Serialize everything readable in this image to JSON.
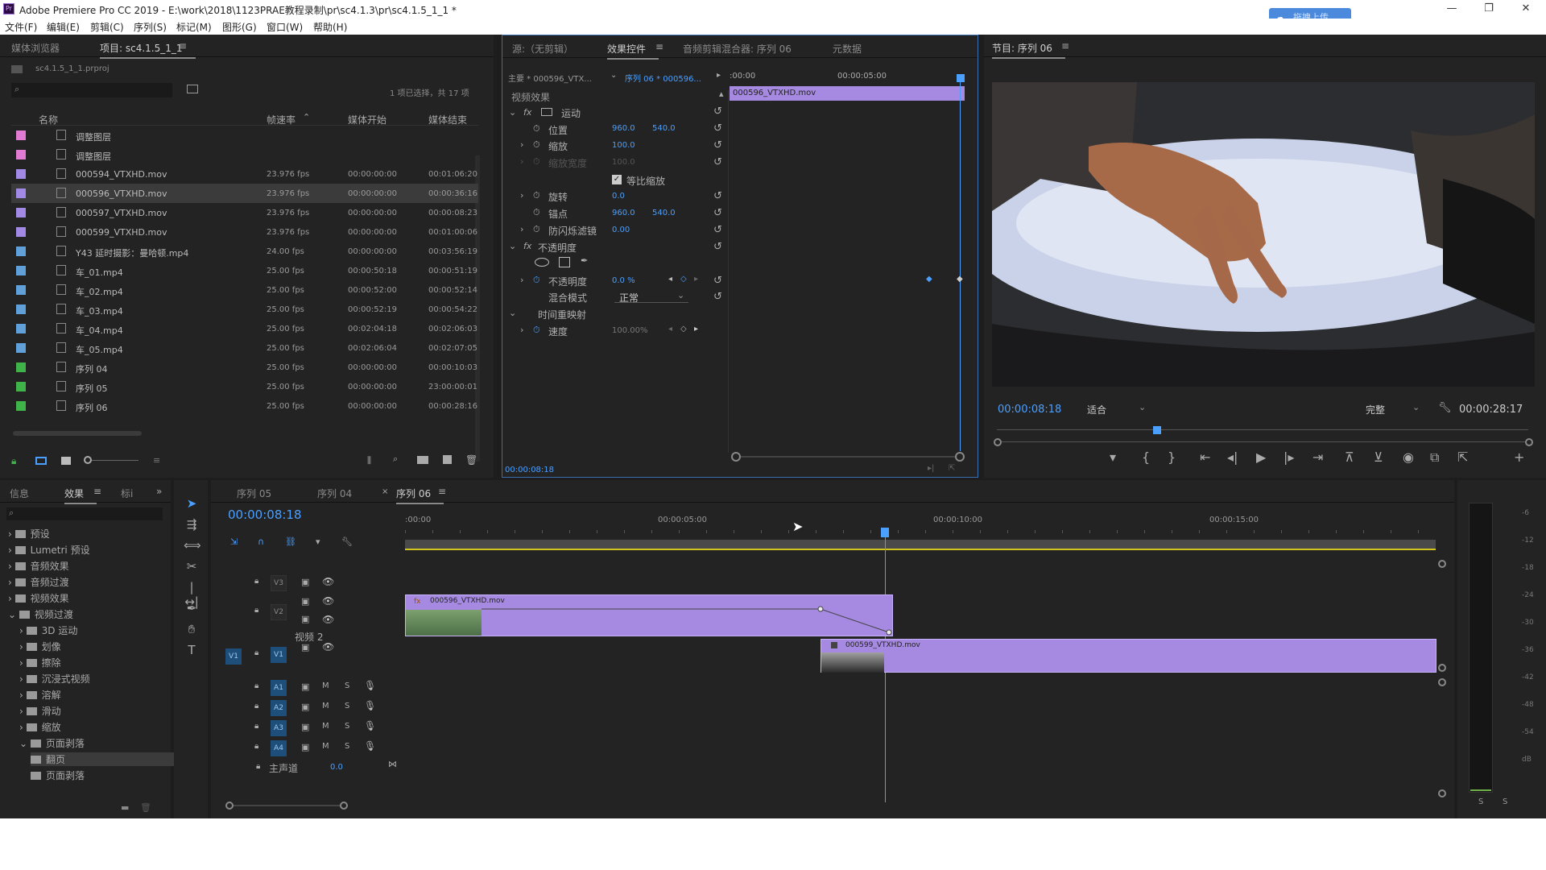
{
  "window": {
    "app_icon": "Pr",
    "title": "Adobe Premiere Pro CC 2019 - E:\\work\\2018\\1123PRAE教程录制\\pr\\sc4.1.3\\pr\\sc4.1.5_1_1 *",
    "upload_label": "拖拽上传",
    "minimize": "—",
    "maximize": "❐",
    "close": "✕"
  },
  "menu": [
    "文件(F)",
    "编辑(E)",
    "剪辑(C)",
    "序列(S)",
    "标记(M)",
    "图形(G)",
    "窗口(W)",
    "帮助(H)"
  ],
  "project": {
    "tabs": [
      "媒体浏览器",
      "项目: sc4.1.5_1_1"
    ],
    "file": "sc4.1.5_1_1.prproj",
    "status": "1 项已选择，共 17 项",
    "columns": [
      "名称",
      "帧速率",
      "媒体开始",
      "媒体结束"
    ],
    "rows": [
      {
        "name": "调整图层",
        "fps": "",
        "start": "",
        "end": "",
        "color": "#e07bd4",
        "icon": "adjust-icon"
      },
      {
        "name": "调整图层",
        "fps": "",
        "start": "",
        "end": "",
        "color": "#e07bd4",
        "icon": "adjust-icon"
      },
      {
        "name": "000594_VTXHD.mov",
        "fps": "23.976 fps",
        "start": "00:00:00:00",
        "end": "00:01:06:20",
        "color": "#a18ae6",
        "icon": "clip-icon"
      },
      {
        "name": "000596_VTXHD.mov",
        "fps": "23.976 fps",
        "start": "00:00:00:00",
        "end": "00:00:36:16",
        "color": "#a18ae6",
        "icon": "clip-icon"
      },
      {
        "name": "000597_VTXHD.mov",
        "fps": "23.976 fps",
        "start": "00:00:00:00",
        "end": "00:00:08:23",
        "color": "#a18ae6",
        "icon": "clip-icon"
      },
      {
        "name": "000599_VTXHD.mov",
        "fps": "23.976 fps",
        "start": "00:00:00:00",
        "end": "00:01:00:06",
        "color": "#a18ae6",
        "icon": "clip-icon"
      },
      {
        "name": "Y43 延时摄影：曼哈顿.mp4",
        "fps": "24.00 fps",
        "start": "00:00:00:00",
        "end": "00:03:56:19",
        "color": "#5fa0d8",
        "icon": "av-clip-icon"
      },
      {
        "name": "车_01.mp4",
        "fps": "25.00 fps",
        "start": "00:00:50:18",
        "end": "00:00:51:19",
        "color": "#5fa0d8",
        "icon": "av-clip-icon"
      },
      {
        "name": "车_02.mp4",
        "fps": "25.00 fps",
        "start": "00:00:52:00",
        "end": "00:00:52:14",
        "color": "#5fa0d8",
        "icon": "av-clip-icon"
      },
      {
        "name": "车_03.mp4",
        "fps": "25.00 fps",
        "start": "00:00:52:19",
        "end": "00:00:54:22",
        "color": "#5fa0d8",
        "icon": "av-clip-icon"
      },
      {
        "name": "车_04.mp4",
        "fps": "25.00 fps",
        "start": "00:02:04:18",
        "end": "00:02:06:03",
        "color": "#5fa0d8",
        "icon": "av-clip-icon"
      },
      {
        "name": "车_05.mp4",
        "fps": "25.00 fps",
        "start": "00:02:06:04",
        "end": "00:02:07:05",
        "color": "#5fa0d8",
        "icon": "av-clip-icon"
      },
      {
        "name": "序列 04",
        "fps": "25.00 fps",
        "start": "00:00:00:00",
        "end": "00:00:10:03",
        "color": "#3fb24a",
        "icon": "sequence-icon"
      },
      {
        "name": "序列 05",
        "fps": "25.00 fps",
        "start": "00:00:00:00",
        "end": "23:00:00:01",
        "color": "#3fb24a",
        "icon": "sequence-icon"
      },
      {
        "name": "序列 06",
        "fps": "25.00 fps",
        "start": "00:00:00:00",
        "end": "00:00:28:16",
        "color": "#3fb24a",
        "icon": "sequence-icon"
      }
    ]
  },
  "effect_controls": {
    "tabs": [
      "源:（无剪辑）",
      "效果控件",
      "音频剪辑混合器: 序列 06",
      "元数据"
    ],
    "master": "主要 * 000596_VTX...",
    "seq": "序列 06 * 000596...",
    "ruler_start": ":00:00",
    "ruler_mid": "00:00:05:00",
    "clip_bar": "000596_VTXHD.mov",
    "section_video": "视频效果",
    "motion": "运动",
    "position_label": "位置",
    "position_x": "960.0",
    "position_y": "540.0",
    "scale_label": "缩放",
    "scale_val": "100.0",
    "scale_w_label": "缩放宽度",
    "scale_w_val": "100.0",
    "uniform_label": "等比缩放",
    "rotate_label": "旋转",
    "rotate_val": "0.0",
    "anchor_label": "锚点",
    "anchor_x": "960.0",
    "anchor_y": "540.0",
    "flicker_label": "防闪烁滤镜",
    "flicker_val": "0.00",
    "opacity_section": "不透明度",
    "opacity_label": "不透明度",
    "opacity_val": "0.0 %",
    "blend_label": "混合模式",
    "blend_val": "正常",
    "timeremap": "时间重映射",
    "speed_label": "速度",
    "speed_val": "100.00%",
    "timecode": "00:00:08:18"
  },
  "program": {
    "title": "节目: 序列 06",
    "timecode": "00:00:08:18",
    "fit": "适合",
    "quality": "完整",
    "duration": "00:00:28:17"
  },
  "effects_panel": {
    "tabs": [
      "信息",
      "效果",
      "标i"
    ],
    "tree": [
      {
        "label": "预设",
        "indent": 0,
        "open": false
      },
      {
        "label": "Lumetri 预设",
        "indent": 0,
        "open": false
      },
      {
        "label": "音频效果",
        "indent": 0,
        "open": false
      },
      {
        "label": "音频过渡",
        "indent": 0,
        "open": false
      },
      {
        "label": "视频效果",
        "indent": 0,
        "open": false
      },
      {
        "label": "视频过渡",
        "indent": 0,
        "open": true
      },
      {
        "label": "3D 运动",
        "indent": 1,
        "open": false
      },
      {
        "label": "划像",
        "indent": 1,
        "open": false
      },
      {
        "label": "擦除",
        "indent": 1,
        "open": false
      },
      {
        "label": "沉浸式视频",
        "indent": 1,
        "open": false
      },
      {
        "label": "溶解",
        "indent": 1,
        "open": false
      },
      {
        "label": "滑动",
        "indent": 1,
        "open": false
      },
      {
        "label": "缩放",
        "indent": 1,
        "open": false
      },
      {
        "label": "页面剥落",
        "indent": 1,
        "open": true
      },
      {
        "label": "翻页",
        "indent": 2,
        "open": false
      },
      {
        "label": "页面剥落",
        "indent": 2,
        "open": false
      }
    ]
  },
  "timeline": {
    "tabs": [
      "序列 05",
      "序列 04",
      "序列 06"
    ],
    "timecode": "00:00:08:18",
    "ruler": [
      ":00:00",
      "00:00:05:00",
      "00:00:10:00",
      "00:00:15:00"
    ],
    "tracks": [
      {
        "id": "V3",
        "name": ""
      },
      {
        "id": "V2",
        "name": "视频 2"
      },
      {
        "id": "V1",
        "name": ""
      },
      {
        "id": "A1",
        "name": ""
      },
      {
        "id": "A2",
        "name": ""
      },
      {
        "id": "A3",
        "name": ""
      },
      {
        "id": "A4",
        "name": ""
      }
    ],
    "master_label": "主声道",
    "master_val": "0.0",
    "clip_v2": "000596_VTXHD.mov",
    "clip_v1": "000599_VTXHD.mov",
    "meter_ticks": [
      "-6",
      "-12",
      "-18",
      "-24",
      "-30",
      "-36",
      "-42",
      "-48",
      "-54",
      "dB"
    ],
    "meter_solo": [
      "S",
      "S"
    ]
  }
}
